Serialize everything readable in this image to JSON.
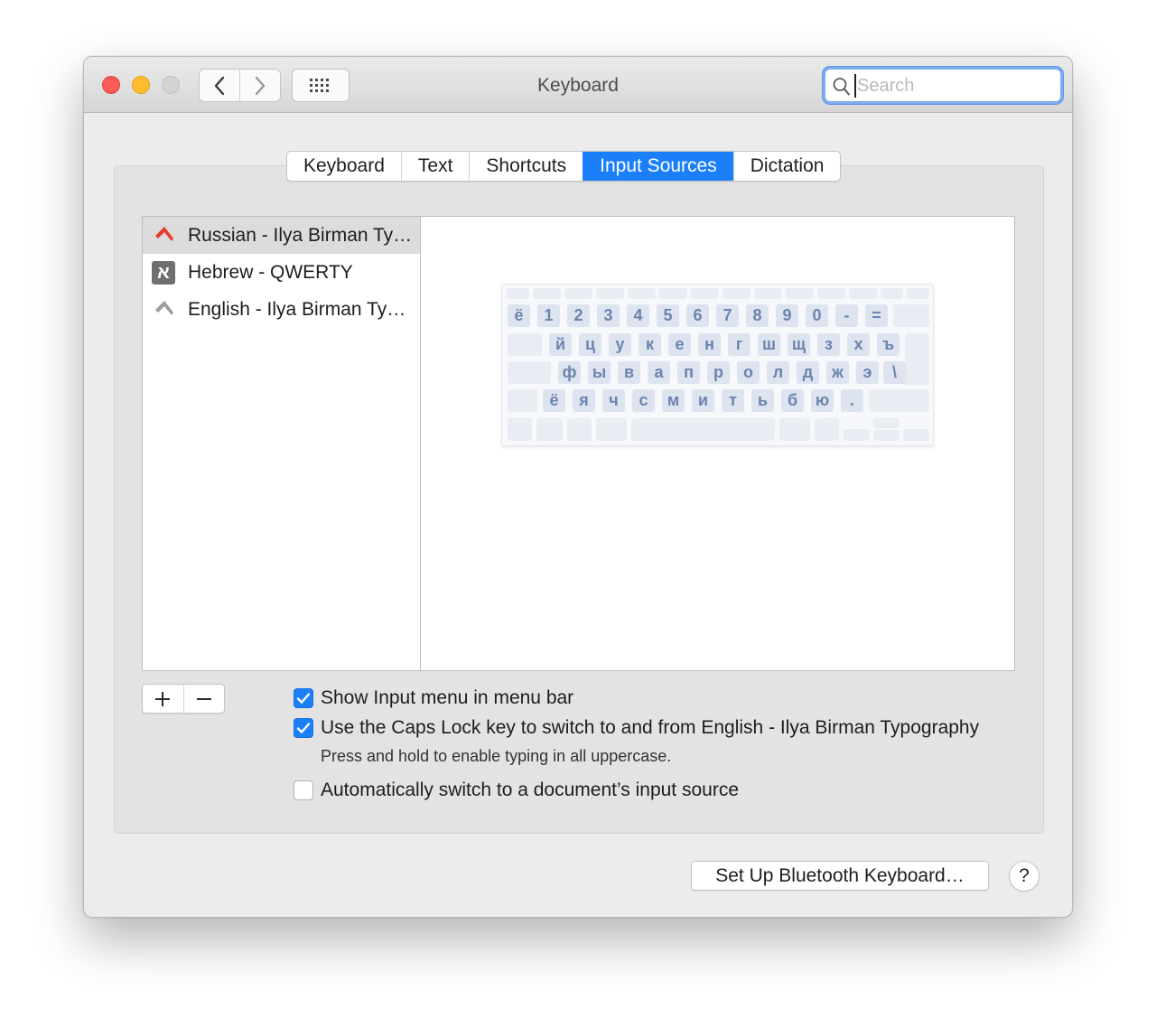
{
  "window": {
    "title": "Keyboard"
  },
  "toolbar": {
    "back_icon": "chevron-left-icon",
    "forward_icon": "chevron-right-icon",
    "grid_icon": "grid-icon"
  },
  "search": {
    "value": "",
    "placeholder": "Search"
  },
  "tabs": [
    {
      "label": "Keyboard",
      "active": false
    },
    {
      "label": "Text",
      "active": false
    },
    {
      "label": "Shortcuts",
      "active": false
    },
    {
      "label": "Input Sources",
      "active": true
    },
    {
      "label": "Dictation",
      "active": false
    }
  ],
  "input_sources": [
    {
      "label": "Russian - Ilya Birman Ty…",
      "icon": "birman-red-icon",
      "selected": true
    },
    {
      "label": "Hebrew - QWERTY",
      "icon": "א",
      "selected": false
    },
    {
      "label": "English - Ilya Birman Ty…",
      "icon": "birman-gray-icon",
      "selected": false
    }
  ],
  "keyboard": {
    "row1": [
      "ё",
      "1",
      "2",
      "3",
      "4",
      "5",
      "6",
      "7",
      "8",
      "9",
      "0",
      "-",
      "="
    ],
    "row2": [
      "й",
      "ц",
      "у",
      "к",
      "е",
      "н",
      "г",
      "ш",
      "щ",
      "з",
      "х",
      "ъ"
    ],
    "row3": [
      "ф",
      "ы",
      "в",
      "а",
      "п",
      "р",
      "о",
      "л",
      "д",
      "ж",
      "э",
      "\\"
    ],
    "row4": [
      "ё",
      "я",
      "ч",
      "с",
      "м",
      "и",
      "т",
      "ь",
      "б",
      "ю",
      "."
    ]
  },
  "list_controls": {
    "add": "+",
    "remove": "—"
  },
  "options": {
    "show_menu": {
      "label": "Show Input menu in menu bar",
      "checked": true
    },
    "caps_lock": {
      "label": "Use the Caps Lock key to switch to and from English - Ilya Birman Typography",
      "checked": true
    },
    "caps_lock_hint": "Press and hold to enable typing in all uppercase.",
    "auto_switch": {
      "label": "Automatically switch to a document’s input source",
      "checked": false
    }
  },
  "buttons": {
    "bluetooth": "Set Up Bluetooth Keyboard…",
    "help": "?"
  },
  "colors": {
    "accent": "#1a7ff9",
    "key_text": "#6c84ad"
  }
}
